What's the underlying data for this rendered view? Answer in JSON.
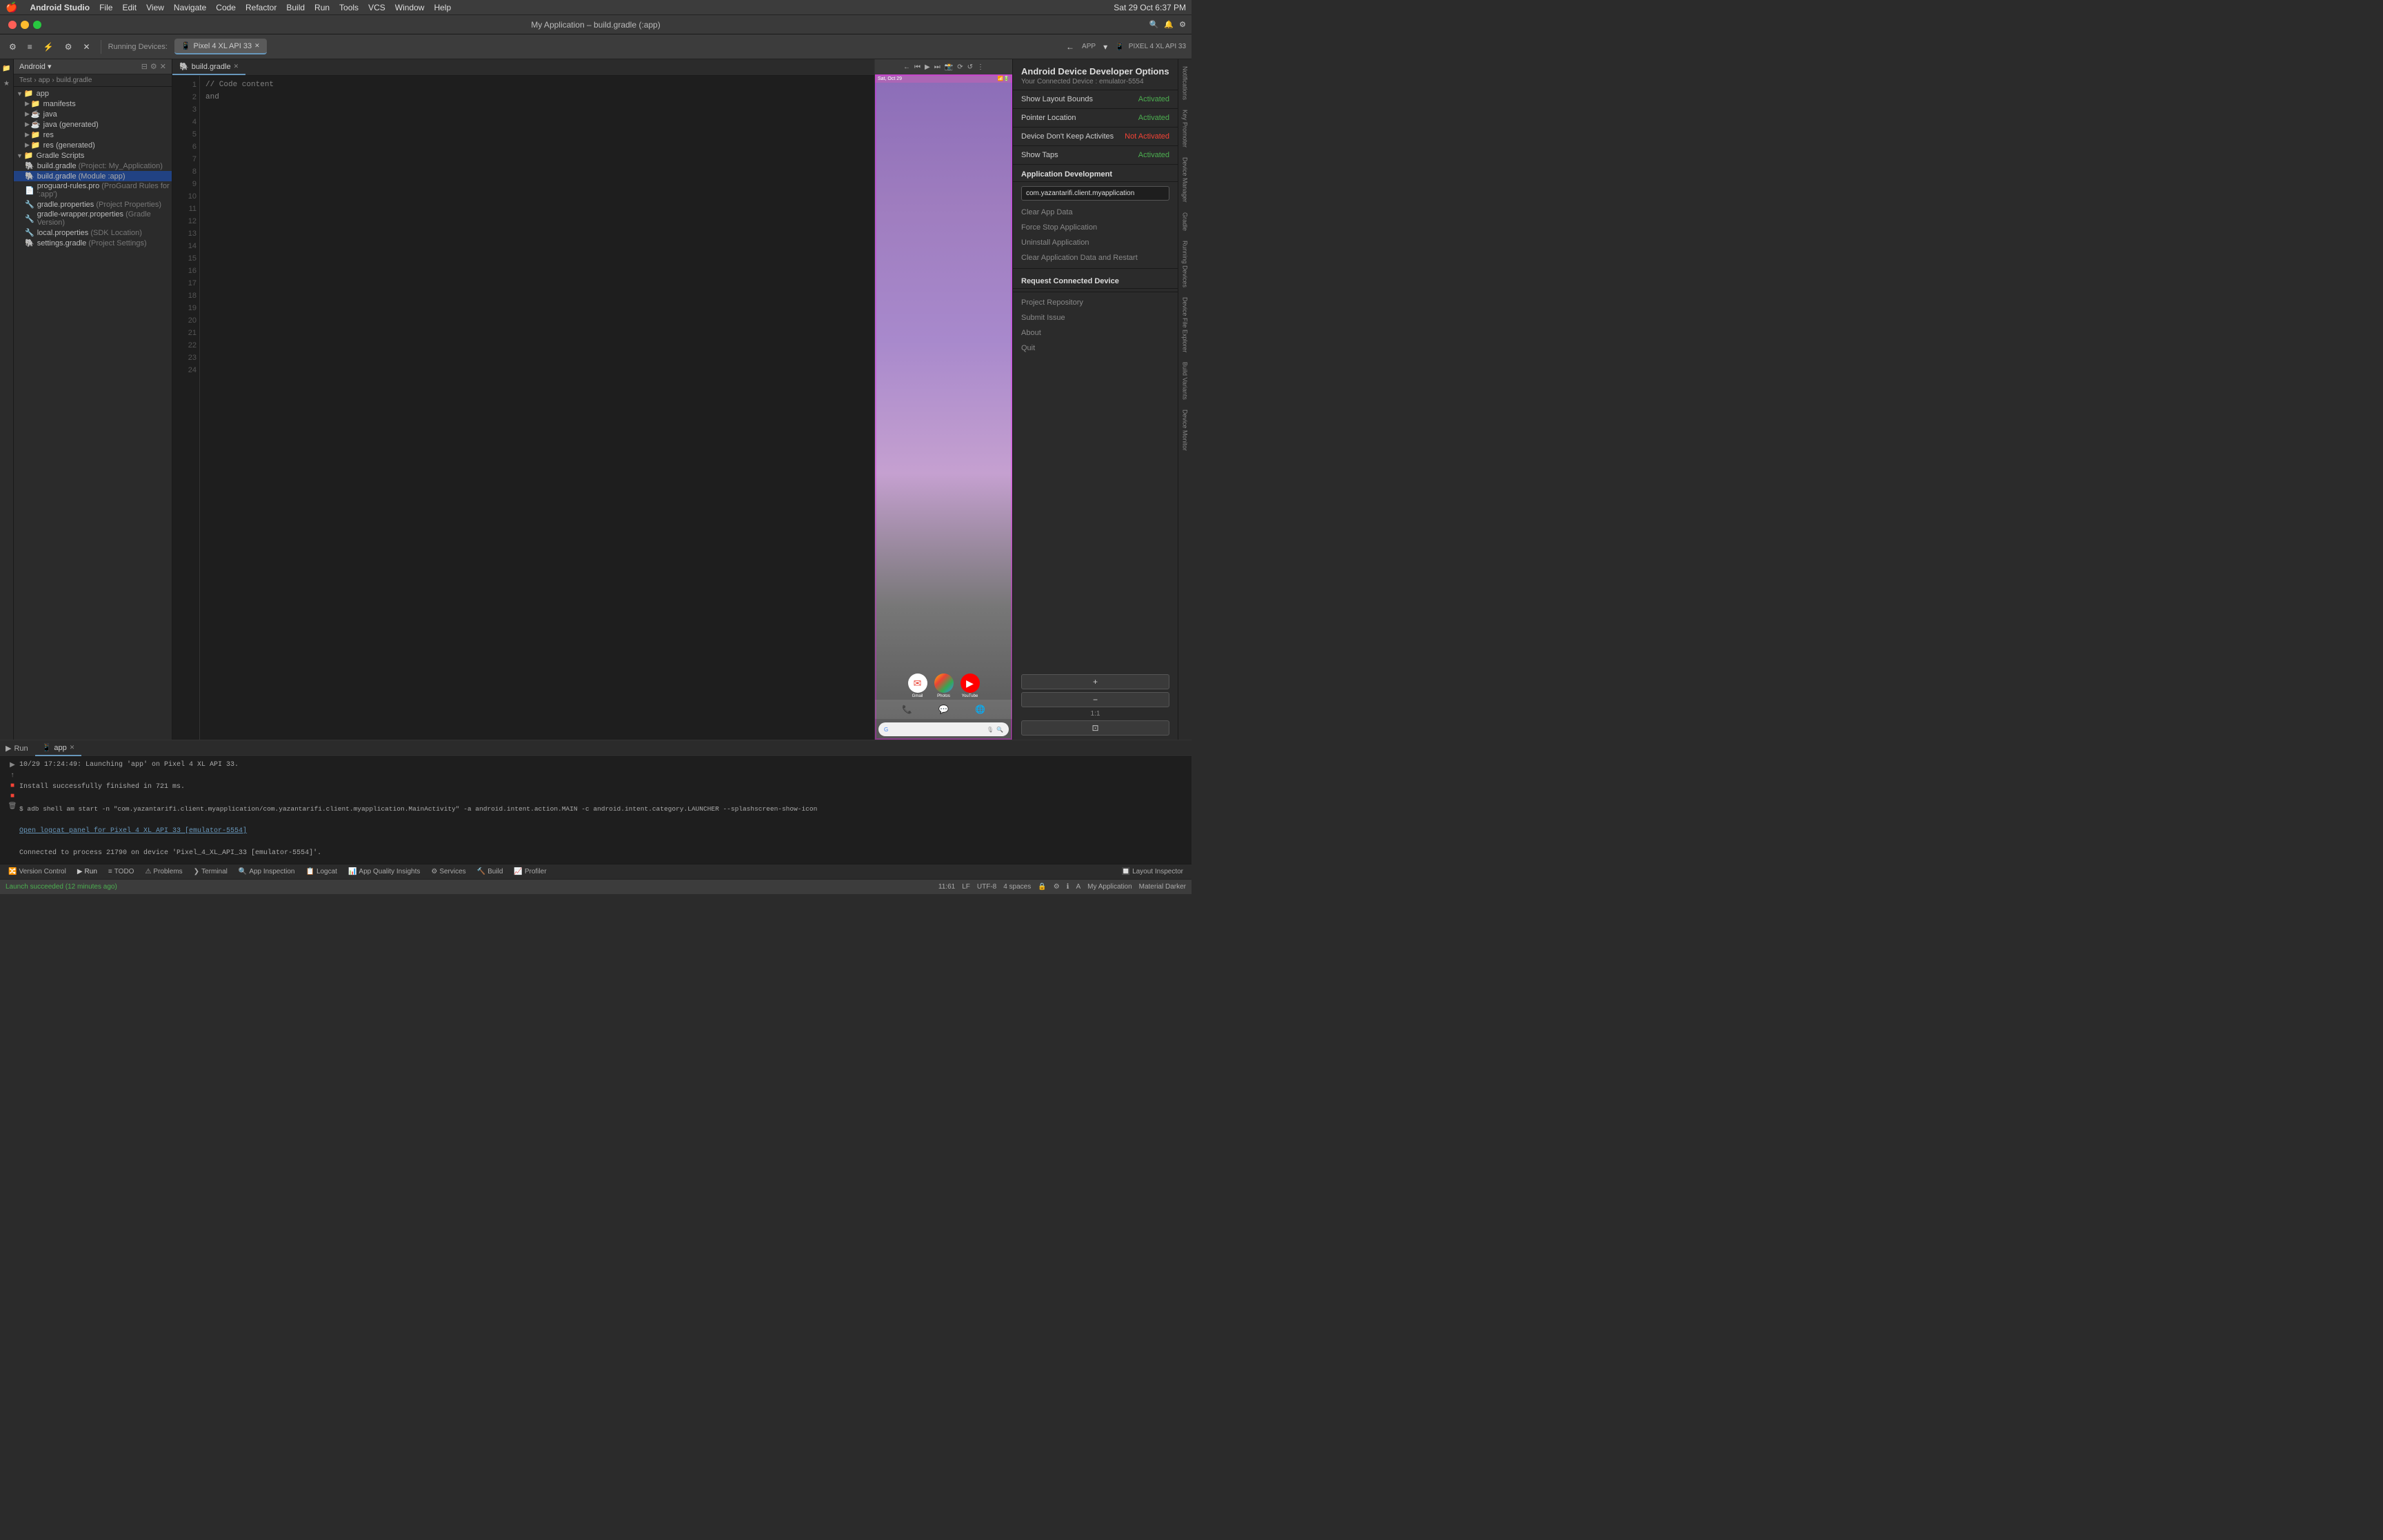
{
  "menubar": {
    "apple": "🍎",
    "app_name": "Android Studio",
    "items": [
      "File",
      "Edit",
      "View",
      "Navigate",
      "Code",
      "Refactor",
      "Build",
      "Run",
      "Tools",
      "VCS",
      "Window",
      "Help"
    ],
    "right_time": "Sat 29 Oct  6:37 PM"
  },
  "titlebar": {
    "title": "My Application – build.gradle (:app)"
  },
  "toolbar": {
    "running_devices_label": "Running Devices:",
    "device_tab": "Pixel 4 XL API 33",
    "app_label": "APP",
    "device_label": "PIXEL 4 XL API 33",
    "back_btn": "←",
    "arrow_btn": "▶"
  },
  "breadcrumb": {
    "items": [
      "Test",
      "app",
      "build.gradle"
    ]
  },
  "file_tree": {
    "root_label": "Android",
    "items": [
      {
        "level": 0,
        "label": "app",
        "type": "folder",
        "expanded": true
      },
      {
        "level": 1,
        "label": "manifests",
        "type": "folder"
      },
      {
        "level": 1,
        "label": "java",
        "type": "folder"
      },
      {
        "level": 1,
        "label": "java (generated)",
        "type": "folder"
      },
      {
        "level": 1,
        "label": "res",
        "type": "folder"
      },
      {
        "level": 1,
        "label": "res (generated)",
        "type": "folder"
      },
      {
        "level": 0,
        "label": "Gradle Scripts",
        "type": "folder",
        "expanded": true
      },
      {
        "level": 1,
        "label": "build.gradle",
        "suffix": "(Project: My_Application)",
        "type": "gradle"
      },
      {
        "level": 1,
        "label": "build.gradle",
        "suffix": "(Module :app)",
        "type": "gradle",
        "selected": true
      },
      {
        "level": 1,
        "label": "proguard-rules.pro",
        "suffix": "(ProGuard Rules for ':app')",
        "type": "proguard"
      },
      {
        "level": 1,
        "label": "gradle.properties",
        "suffix": "(Project Properties)",
        "type": "gradle_props"
      },
      {
        "level": 1,
        "label": "gradle-wrapper.properties",
        "suffix": "(Gradle Version)",
        "type": "gradle_props"
      },
      {
        "level": 1,
        "label": "local.properties",
        "suffix": "(SDK Location)",
        "type": "gradle_props"
      },
      {
        "level": 1,
        "label": "settings.gradle",
        "suffix": "(Project Settings)",
        "type": "gradle"
      }
    ]
  },
  "editor": {
    "tab_label": "build.gradle",
    "line_count": 24,
    "line_at_bottom": "and"
  },
  "emulator": {
    "device_name": "Pixel 4 XL API 33",
    "status_bar_time": "Sat, Oct 29",
    "app_icons": [
      {
        "name": "Gmail",
        "emoji": "✉"
      },
      {
        "name": "Photos",
        "emoji": "🖼"
      },
      {
        "name": "YouTube",
        "emoji": "▶"
      }
    ],
    "navbar_icons": [
      "📞",
      "💬",
      "🌐"
    ]
  },
  "dev_options": {
    "title": "Android Device Developer Options",
    "subtitle": "Your Connected Device : emulator-5554",
    "options": [
      {
        "label": "Show Layout Bounds",
        "value": "Activated",
        "status": "activated"
      },
      {
        "label": "Pointer Location",
        "value": "Activated",
        "status": "activated"
      },
      {
        "label": "Device Don't Keep Activites",
        "value": "Not Activated",
        "status": "not_activated"
      },
      {
        "label": "Show Taps",
        "value": "Activated",
        "status": "activated"
      }
    ],
    "app_dev": {
      "section_label": "Application Development",
      "package_input": "com.yazantarifi.client.myapplication",
      "actions": [
        "Clear App Data",
        "Force Stop Application",
        "Uninstall Application",
        "Clear Application Data and Restart"
      ]
    },
    "request_device": {
      "label": "Request Connected Device"
    },
    "misc": {
      "project_repo": "Project Repository",
      "submit_issue": "Submit Issue",
      "about": "About",
      "quit": "Quit"
    }
  },
  "run_panel": {
    "tab_label": "Run",
    "app_tab": "app",
    "log_lines": [
      "10/29 17:24:49: Launching 'app' on Pixel 4 XL API 33.",
      "",
      "Install successfully finished in 721 ms.",
      "",
      "$ adb shell am start -n \"com.yazantarifi.client.myapplication/com.yazantarifi.client.myapplication.MainActivity\" -a android.intent.action.MAIN -c android.intent.category.LAUNCHER --splashscreen-show-icon",
      "",
      "Open logcat panel for Pixel 4 XL API 33 [emulator-5554]",
      "",
      "Connected to process 21790 on device 'Pixel_4_XL_API_33 [emulator-5554]'."
    ],
    "logcat_link": "Open logcat panel for Pixel 4 XL API 33 [emulator-5554]"
  },
  "status_bar": {
    "cursor_pos": "11:61",
    "line_ending": "LF",
    "encoding": "UTF-8",
    "indent": "4 spaces",
    "launch_status": "Launch succeeded (12 minutes ago)",
    "app_name": "My Application",
    "material_darker": "Material Darker"
  },
  "bottom_toolbar": {
    "items": [
      {
        "label": "Version Control",
        "icon": "🔀"
      },
      {
        "label": "Run",
        "icon": "▶",
        "active": true
      },
      {
        "label": "TODO",
        "icon": "≡"
      },
      {
        "label": "Problems",
        "icon": "⚠"
      },
      {
        "label": "Terminal",
        "icon": ">"
      },
      {
        "label": "App Inspection",
        "icon": "🔍"
      },
      {
        "label": "Logcat",
        "icon": "📋"
      },
      {
        "label": "App Quality Insights",
        "icon": "📊"
      },
      {
        "label": "Services",
        "icon": "⚙"
      },
      {
        "label": "Build",
        "icon": "🔨"
      },
      {
        "label": "Profiler",
        "icon": "📈"
      },
      {
        "label": "Layout Inspector",
        "icon": "🔲"
      }
    ]
  },
  "right_sidebar_tabs": [
    "Notifications",
    "Key Promoter",
    "Device Manager",
    "Gradle",
    "Running Devices",
    "Device File Explorer",
    "Build Variants",
    "Device Monitor"
  ],
  "zoom_controls": {
    "plus": "+",
    "minus": "−",
    "ratio": "1:1",
    "fit": "⊡"
  }
}
